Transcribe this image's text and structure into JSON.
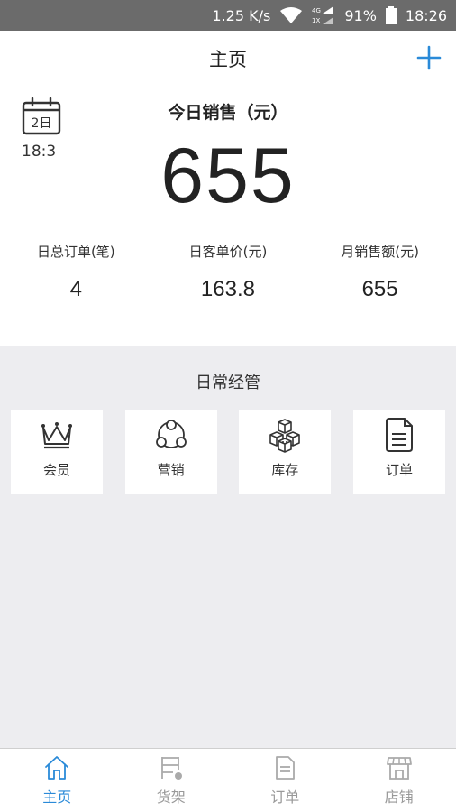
{
  "status_bar": {
    "net_speed": "1.25 K/s",
    "battery": "91%",
    "time": "18:26"
  },
  "header": {
    "title": "主页",
    "add_icon": "plus-icon"
  },
  "summary": {
    "calendar_day": "2日",
    "time": "18:3",
    "sales_title": "今日销售（元）",
    "sales_value": "655",
    "stats": [
      {
        "label": "日总订单(笔)",
        "value": "4"
      },
      {
        "label": "日客单价(元)",
        "value": "163.8"
      },
      {
        "label": "月销售额(元)",
        "value": "655"
      }
    ]
  },
  "daily": {
    "title": "日常经管",
    "tiles": [
      {
        "label": "会员",
        "icon": "crown-icon"
      },
      {
        "label": "营销",
        "icon": "network-icon"
      },
      {
        "label": "库存",
        "icon": "boxes-icon"
      },
      {
        "label": "订单",
        "icon": "document-icon"
      }
    ]
  },
  "nav": {
    "items": [
      {
        "label": "主页",
        "icon": "home-icon",
        "active": true
      },
      {
        "label": "货架",
        "icon": "shelf-icon",
        "active": false
      },
      {
        "label": "订单",
        "icon": "order-icon",
        "active": false
      },
      {
        "label": "店铺",
        "icon": "store-icon",
        "active": false
      }
    ]
  },
  "colors": {
    "accent": "#2a8ad8",
    "status_bar": "#6b6b6b",
    "background": "#ededf0"
  }
}
